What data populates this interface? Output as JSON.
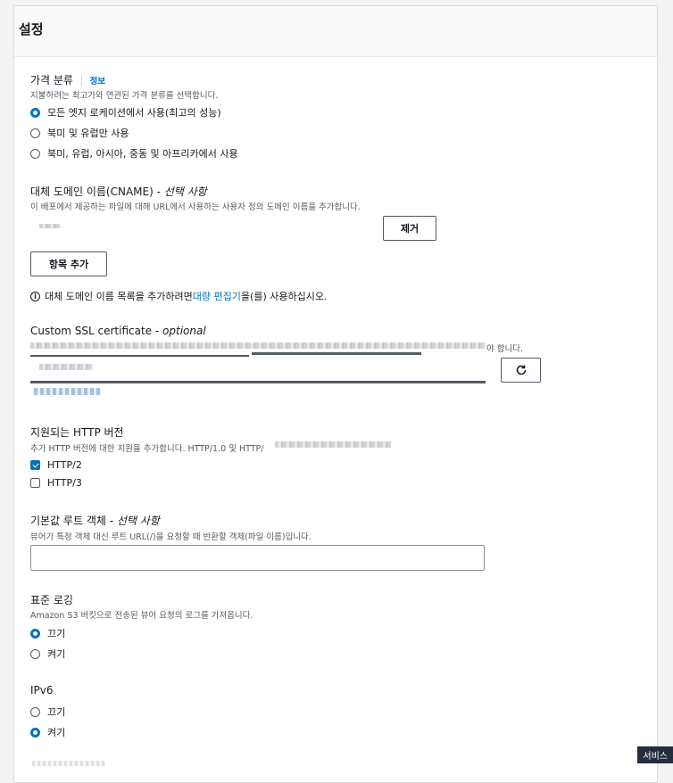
{
  "panel": {
    "title": "설정"
  },
  "price_class": {
    "label": "가격 분류",
    "info": "정보",
    "description": "지불하려는 최고가와 연관된 가격 분류를 선택합니다.",
    "options": [
      {
        "label": "모든 엣지 로케이션에서 사용(최고의 성능)",
        "selected": true
      },
      {
        "label": "북미 및 유럽만 사용",
        "selected": false
      },
      {
        "label": "북미, 유럽, 아시아, 중동 및 아프리카에서 사용",
        "selected": false
      }
    ]
  },
  "cname": {
    "label": "대체 도메인 이름(CNAME) - ",
    "optional": "선택 사항",
    "description": "이 배포에서 제공하는 파일에 대해 URL에서 사용하는 사용자 정의 도메인 이름을 추가합니다.",
    "remove_label": "제거",
    "add_label": "항목 추가",
    "info_prefix": "대체 도메인 이름 목록을 추가하려면 ",
    "info_link": "대량 편집기",
    "info_suffix": "을(를) 사용하십시오."
  },
  "ssl": {
    "label": "Custom SSL certificate - ",
    "optional": "optional",
    "description_suffix": "야 합니다."
  },
  "http_versions": {
    "label": "지원되는 HTTP 버전",
    "description": "추가 HTTP 버전에 대한 지원을 추가합니다. HTTP/1.0 및 HTTP/",
    "options": [
      {
        "label": "HTTP/2",
        "checked": true
      },
      {
        "label": "HTTP/3",
        "checked": false
      }
    ]
  },
  "root_object": {
    "label": "기본값 루트 객체 - ",
    "optional": "선택 사항",
    "description": "뷰어가 특정 객체 대신 루트 URL(/)을 요청할 때 반환할 객체(파일 이름)입니다.",
    "value": ""
  },
  "logging": {
    "label": "표준 로깅",
    "description": "Amazon S3 버킷으로 전송된 뷰어 요청의 로그를 가져옵니다.",
    "options": [
      {
        "label": "끄기",
        "selected": true
      },
      {
        "label": "켜기",
        "selected": false
      }
    ]
  },
  "ipv6": {
    "label": "IPv6",
    "options": [
      {
        "label": "끄기",
        "selected": false
      },
      {
        "label": "켜기",
        "selected": true
      }
    ]
  },
  "tooltip": {
    "text": "서비스"
  },
  "colors": {
    "accent": "#0073bb",
    "text": "#16191f",
    "muted": "#545b64"
  }
}
